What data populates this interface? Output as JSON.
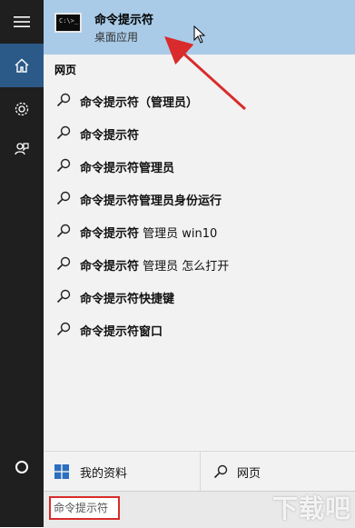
{
  "best_match": {
    "title": "命令提示符",
    "subtitle": "桌面应用",
    "icon": "cmd-icon",
    "icon_text": "C:\\>_"
  },
  "section": {
    "label": "网页"
  },
  "results": [
    {
      "bold": "命令提示符（管理员）",
      "normal": ""
    },
    {
      "bold": "命令提示符",
      "normal": ""
    },
    {
      "bold": "命令提示符管理员",
      "normal": ""
    },
    {
      "bold": "命令提示符管理员身份运行",
      "normal": ""
    },
    {
      "bold": "命令提示符",
      "normal": " 管理员 win10"
    },
    {
      "bold": "命令提示符",
      "normal": " 管理员 怎么打开"
    },
    {
      "bold": "命令提示符快捷键",
      "normal": ""
    },
    {
      "bold": "命令提示符窗口",
      "normal": ""
    }
  ],
  "tabs": {
    "mine": "我的资料",
    "web": "网页"
  },
  "search": {
    "value": "命令提示符"
  },
  "watermark": "下载吧",
  "colors": {
    "rail": "#1f1f1f",
    "rail_active": "#2b5a88",
    "highlight": "#a9cbe8",
    "annotation": "#d92b2b"
  }
}
